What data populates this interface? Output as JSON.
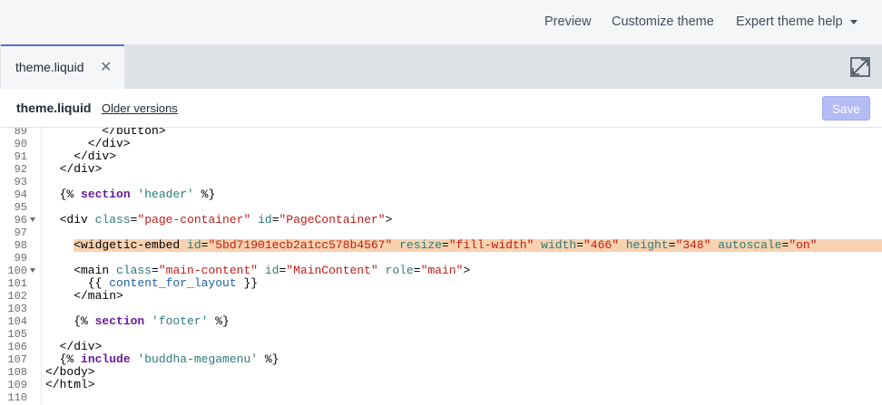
{
  "topbar": {
    "preview": "Preview",
    "customize": "Customize theme",
    "expert": "Expert theme help"
  },
  "tab": {
    "label": "theme.liquid",
    "close": "✕"
  },
  "filebar": {
    "filename": "theme.liquid",
    "older_versions": "Older versions",
    "save": "Save"
  },
  "editor": {
    "lines": [
      {
        "n": "89",
        "fold": false,
        "hl": false,
        "tokens": [
          {
            "t": "        </button>",
            "c": "tag"
          }
        ]
      },
      {
        "n": "90",
        "fold": false,
        "hl": false,
        "tokens": [
          {
            "t": "      </div>",
            "c": "tag"
          }
        ]
      },
      {
        "n": "91",
        "fold": false,
        "hl": false,
        "tokens": [
          {
            "t": "    </div>",
            "c": "tag"
          }
        ]
      },
      {
        "n": "92",
        "fold": false,
        "hl": false,
        "tokens": [
          {
            "t": "  </div>",
            "c": "tag"
          }
        ]
      },
      {
        "n": "93",
        "fold": false,
        "hl": false,
        "tokens": []
      },
      {
        "n": "94",
        "fold": false,
        "hl": false,
        "tokens": [
          {
            "t": "  {% ",
            "c": "tag"
          },
          {
            "t": "section",
            "c": "kw"
          },
          {
            "t": " ",
            "c": "tag"
          },
          {
            "t": "'header'",
            "c": "lstr"
          },
          {
            "t": " %}",
            "c": "tag"
          }
        ]
      },
      {
        "n": "95",
        "fold": false,
        "hl": false,
        "tokens": []
      },
      {
        "n": "96",
        "fold": true,
        "hl": false,
        "tokens": [
          {
            "t": "  <div ",
            "c": "tag"
          },
          {
            "t": "class",
            "c": "attr"
          },
          {
            "t": "=",
            "c": "tag"
          },
          {
            "t": "\"page-container\"",
            "c": "str"
          },
          {
            "t": " ",
            "c": "tag"
          },
          {
            "t": "id",
            "c": "attr"
          },
          {
            "t": "=",
            "c": "tag"
          },
          {
            "t": "\"PageContainer\"",
            "c": "str"
          },
          {
            "t": ">",
            "c": "tag"
          }
        ]
      },
      {
        "n": "97",
        "fold": false,
        "hl": false,
        "tokens": []
      },
      {
        "n": "98",
        "fold": false,
        "hl": true,
        "tokens": [
          {
            "t": "    <widgetic-embed ",
            "c": "tag"
          },
          {
            "t": "id",
            "c": "attr"
          },
          {
            "t": "=",
            "c": "tag"
          },
          {
            "t": "\"5bd71901ecb2a1cc578b4567\"",
            "c": "str"
          },
          {
            "t": " ",
            "c": "tag"
          },
          {
            "t": "resize",
            "c": "attr"
          },
          {
            "t": "=",
            "c": "tag"
          },
          {
            "t": "\"fill-width\"",
            "c": "str"
          },
          {
            "t": " ",
            "c": "tag"
          },
          {
            "t": "width",
            "c": "attr"
          },
          {
            "t": "=",
            "c": "tag"
          },
          {
            "t": "\"466\"",
            "c": "str"
          },
          {
            "t": " ",
            "c": "tag"
          },
          {
            "t": "height",
            "c": "attr"
          },
          {
            "t": "=",
            "c": "tag"
          },
          {
            "t": "\"348\"",
            "c": "str"
          },
          {
            "t": " ",
            "c": "tag"
          },
          {
            "t": "autoscale",
            "c": "attr"
          },
          {
            "t": "=",
            "c": "tag"
          },
          {
            "t": "\"on\"",
            "c": "str"
          }
        ]
      },
      {
        "n": "99",
        "fold": false,
        "hl": false,
        "tokens": []
      },
      {
        "n": "100",
        "fold": true,
        "hl": false,
        "tokens": [
          {
            "t": "    <main ",
            "c": "tag"
          },
          {
            "t": "class",
            "c": "attr"
          },
          {
            "t": "=",
            "c": "tag"
          },
          {
            "t": "\"main-content\"",
            "c": "str"
          },
          {
            "t": " ",
            "c": "tag"
          },
          {
            "t": "id",
            "c": "attr"
          },
          {
            "t": "=",
            "c": "tag"
          },
          {
            "t": "\"MainContent\"",
            "c": "str"
          },
          {
            "t": " ",
            "c": "tag"
          },
          {
            "t": "role",
            "c": "attr"
          },
          {
            "t": "=",
            "c": "tag"
          },
          {
            "t": "\"main\"",
            "c": "str"
          },
          {
            "t": ">",
            "c": "tag"
          }
        ]
      },
      {
        "n": "101",
        "fold": false,
        "hl": false,
        "tokens": [
          {
            "t": "      {{ ",
            "c": "tag"
          },
          {
            "t": "content_for_layout",
            "c": "var"
          },
          {
            "t": " }}",
            "c": "tag"
          }
        ]
      },
      {
        "n": "102",
        "fold": false,
        "hl": false,
        "tokens": [
          {
            "t": "    </main>",
            "c": "tag"
          }
        ]
      },
      {
        "n": "103",
        "fold": false,
        "hl": false,
        "tokens": []
      },
      {
        "n": "104",
        "fold": false,
        "hl": false,
        "tokens": [
          {
            "t": "    {% ",
            "c": "tag"
          },
          {
            "t": "section",
            "c": "kw"
          },
          {
            "t": " ",
            "c": "tag"
          },
          {
            "t": "'footer'",
            "c": "lstr"
          },
          {
            "t": " %}",
            "c": "tag"
          }
        ]
      },
      {
        "n": "105",
        "fold": false,
        "hl": false,
        "tokens": []
      },
      {
        "n": "106",
        "fold": false,
        "hl": false,
        "tokens": [
          {
            "t": "  </div>",
            "c": "tag"
          }
        ]
      },
      {
        "n": "107",
        "fold": false,
        "hl": false,
        "tokens": [
          {
            "t": "  {% ",
            "c": "tag"
          },
          {
            "t": "include",
            "c": "kw"
          },
          {
            "t": " ",
            "c": "tag"
          },
          {
            "t": "'buddha-megamenu'",
            "c": "lstr"
          },
          {
            "t": " %}",
            "c": "tag"
          }
        ]
      },
      {
        "n": "108",
        "fold": false,
        "hl": false,
        "tokens": [
          {
            "t": "</body>",
            "c": "tag"
          }
        ]
      },
      {
        "n": "109",
        "fold": false,
        "hl": false,
        "tokens": [
          {
            "t": "</html>",
            "c": "tag"
          }
        ]
      },
      {
        "n": "110",
        "fold": false,
        "hl": false,
        "tokens": []
      }
    ]
  }
}
